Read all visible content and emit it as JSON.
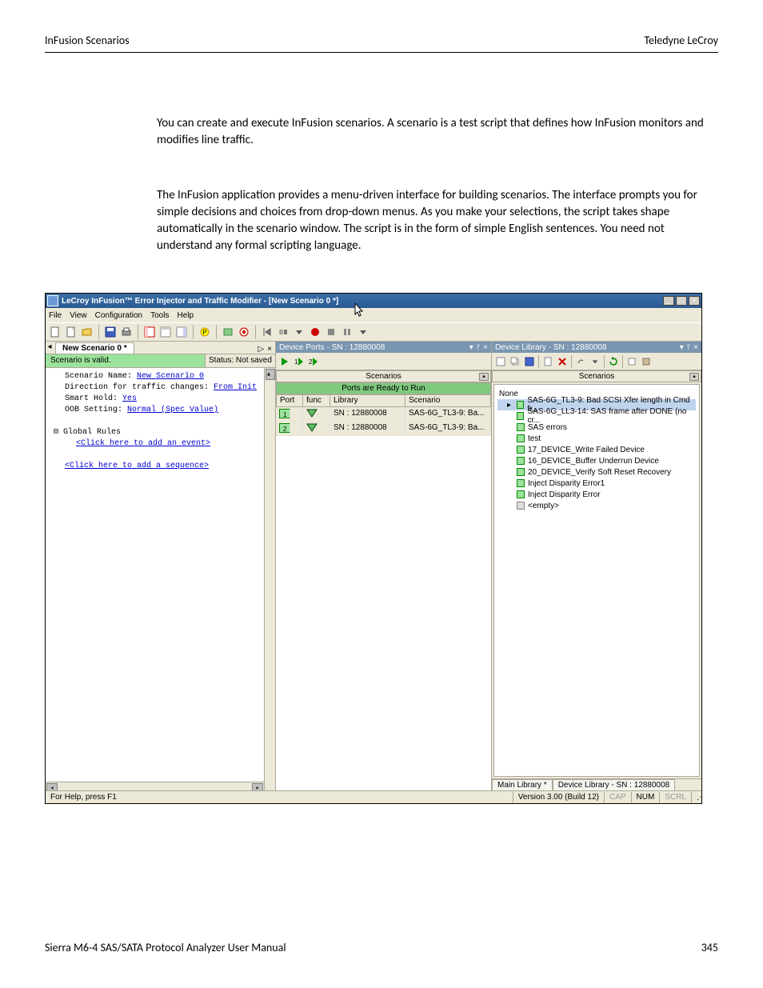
{
  "page": {
    "header_left": "InFusion Scenarios",
    "header_right": "Teledyne LeCroy",
    "para1": "You can create and execute InFusion scenarios. A scenario is a test script that defines how InFusion monitors and modifies line traffic.",
    "para2": "The InFusion application provides a menu-driven interface for building scenarios. The interface prompts you for simple decisions and choices from drop-down menus. As you make your selections, the script takes shape automatically in the scenario window. The script is in the form of simple English sentences. You need not understand any formal scripting language.",
    "footer_left": "Sierra M6-4 SAS/SATA Protocol Analyzer User Manual",
    "footer_right": "345"
  },
  "app": {
    "title": "LeCroy InFusion™ Error Injector and Traffic Modifier - [New Scenario 0 *]",
    "menu": [
      "File",
      "View",
      "Configuration",
      "Tools",
      "Help"
    ],
    "tab_label": "New Scenario 0 *",
    "status_valid": "Scenario is valid.",
    "status_saved": "Status: Not saved",
    "editor": {
      "scenario_name_label": "Scenario Name: ",
      "scenario_name_link": "New Scenario 0",
      "direction_label": "Direction for traffic changes: ",
      "direction_link": "From Init",
      "smart_hold_label": "Smart Hold: ",
      "smart_hold_link": "Yes",
      "oob_label": "OOB Setting: ",
      "oob_link": "Normal (Spec Value)",
      "global_rules": "Global Rules",
      "add_event": "<Click here to add an event>",
      "add_sequence": "<Click here to add a sequence>"
    },
    "ports_panel": {
      "title": "Device Ports - SN : 12880008",
      "section1": "Scenarios",
      "section2": "Ports are Ready to Run",
      "cols": [
        "Port",
        "func",
        "Library",
        "Scenario"
      ],
      "rows": [
        {
          "port": "1",
          "lib": "SN : 12880008",
          "scen": "SAS-6G_TL3-9: Ba..."
        },
        {
          "port": "2",
          "lib": "SN : 12880008",
          "scen": "SAS-6G_TL3-9: Ba..."
        }
      ]
    },
    "library_panel": {
      "title": "Device Library - SN : 12880008",
      "section": "Scenarios",
      "root": "None",
      "items": [
        {
          "label": "SAS-6G_TL3-9: Bad SCSI Xfer length in Cmd fr...",
          "sel": true
        },
        {
          "label": "SAS-6G_LL3-14: SAS frame after DONE (no cr..."
        },
        {
          "label": "SAS errors"
        },
        {
          "label": "test"
        },
        {
          "label": "17_DEVICE_Write Failed Device"
        },
        {
          "label": "16_DEVICE_Buffer Underrun Device"
        },
        {
          "label": "20_DEVICE_Verify Soft Reset Recovery"
        },
        {
          "label": "Inject Disparity Error1"
        },
        {
          "label": "Inject Disparity Error"
        },
        {
          "label": "<empty>",
          "grey": true
        }
      ],
      "tabs": [
        "Main Library *",
        "Device Library - SN : 12880008"
      ]
    },
    "statusbar": {
      "help": "For Help, press F1",
      "version": "Version 3.00 (Build 12)",
      "cap": "CAP",
      "num": "NUM",
      "scrl": "SCRL"
    }
  }
}
